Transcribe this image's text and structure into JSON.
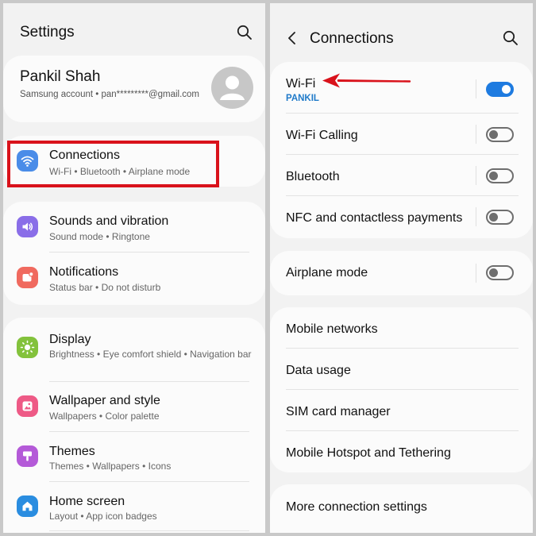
{
  "left": {
    "header": {
      "title": "Settings"
    },
    "profile": {
      "name": "Pankil Shah",
      "subtitle": "Samsung account  •  pan*********@gmail.com"
    },
    "items": [
      {
        "title": "Connections",
        "subtitle": "Wi-Fi  •  Bluetooth  •  Airplane mode",
        "icon": "wifi-icon",
        "color": "#4a8ce8"
      },
      {
        "title": "Sounds and vibration",
        "subtitle": "Sound mode  •  Ringtone",
        "icon": "speaker-icon",
        "color": "#8a6ee8"
      },
      {
        "title": "Notifications",
        "subtitle": "Status bar  •  Do not disturb",
        "icon": "notification-icon",
        "color": "#f06a5f"
      },
      {
        "title": "Display",
        "subtitle": "Brightness  •  Eye comfort shield  •  Navigation bar",
        "icon": "sun-icon",
        "color": "#83c23c"
      },
      {
        "title": "Wallpaper and style",
        "subtitle": "Wallpapers  •  Color palette",
        "icon": "wallpaper-icon",
        "color": "#ee5a86"
      },
      {
        "title": "Themes",
        "subtitle": "Themes  •  Wallpapers  •  Icons",
        "icon": "themes-icon",
        "color": "#b45ad8"
      },
      {
        "title": "Home screen",
        "subtitle": "Layout  •  App icon badges",
        "icon": "home-icon",
        "color": "#2a8de0"
      }
    ]
  },
  "right": {
    "header": {
      "title": "Connections"
    },
    "wifi": {
      "title": "Wi-Fi",
      "network": "PANKIL",
      "on": true
    },
    "toggles": [
      {
        "title": "Wi-Fi Calling",
        "on": false
      },
      {
        "title": "Bluetooth",
        "on": false
      },
      {
        "title": "NFC and contactless payments",
        "on": false
      }
    ],
    "airplane": {
      "title": "Airplane mode",
      "on": false
    },
    "links": [
      {
        "title": "Mobile networks"
      },
      {
        "title": "Data usage"
      },
      {
        "title": "SIM card manager"
      },
      {
        "title": "Mobile Hotspot and Tethering"
      }
    ],
    "more": {
      "title": "More connection settings"
    }
  },
  "colors": {
    "accent": "#1e7be0",
    "highlight": "#d9121b",
    "subtitle_blue": "#1f7ac9"
  }
}
